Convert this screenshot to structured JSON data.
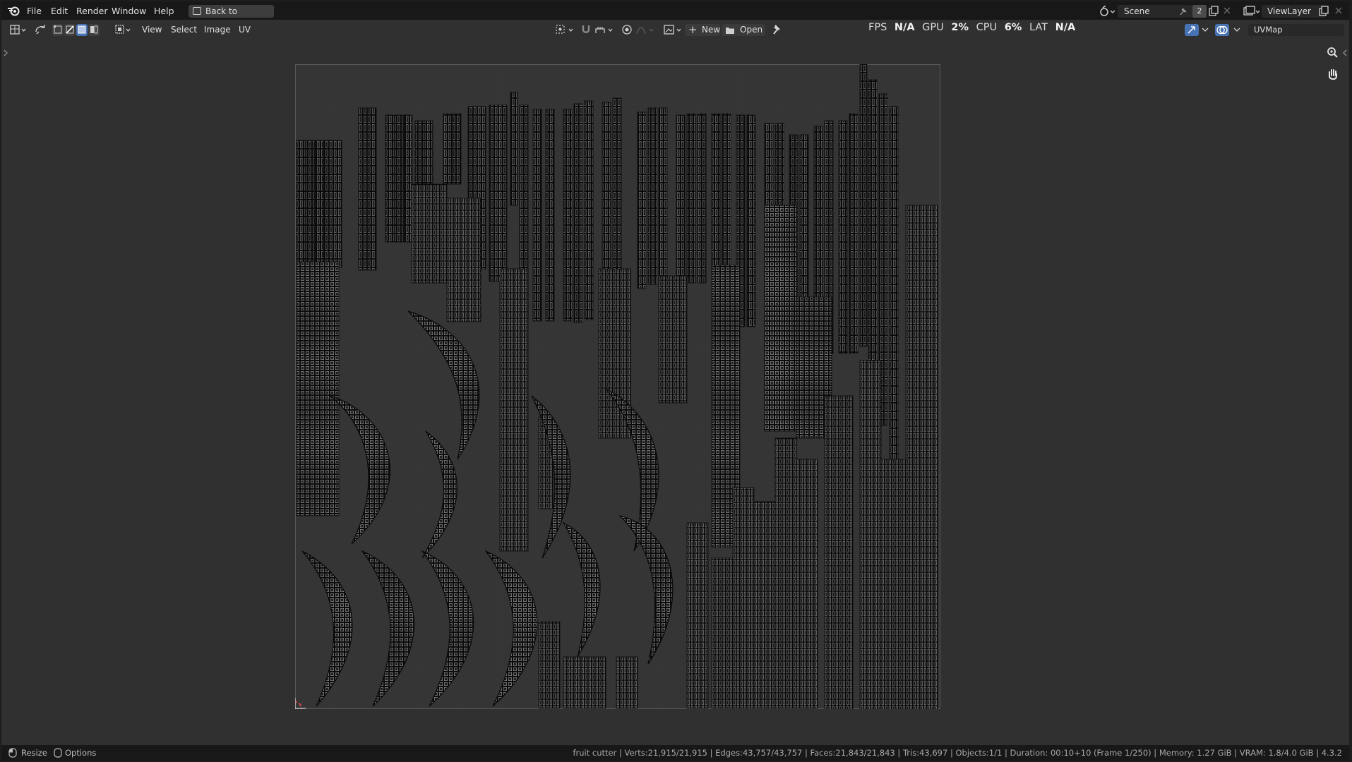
{
  "menus": [
    "File",
    "Edit",
    "Render",
    "Window",
    "Help"
  ],
  "back_button": "Back to Previous",
  "scene": {
    "name": "Scene",
    "count": "2"
  },
  "view_layer": "ViewLayer",
  "editor_menus": [
    "View",
    "Select",
    "Image",
    "UV"
  ],
  "image_buttons": {
    "new": "New",
    "open": "Open"
  },
  "stats": {
    "fps_label": "FPS",
    "fps_value": "N/A",
    "gpu_label": "GPU",
    "gpu_value": "2%",
    "cpu_label": "CPU",
    "cpu_value": "6%",
    "lat_label": "LAT",
    "lat_value": "N/A"
  },
  "uv_map": "UVMap",
  "status": {
    "resize": "Resize",
    "options": "Options",
    "info": "fruit cutter | Verts:21,915/21,915 | Edges:43,757/43,757 | Faces:21,843/21,843 | Tris:43,697 | Objects:1/1 | Duration: 00:10+10 (Frame 1/250) | Memory: 1.27 GiB | VRAM: 1.8/4.0 GiB | 4.3.2"
  },
  "colors": {
    "accent": "#4772b3",
    "uv_edge": "#c8c8c8",
    "uv_face": "#0a0a0a",
    "cursor": "#d84a4a"
  }
}
